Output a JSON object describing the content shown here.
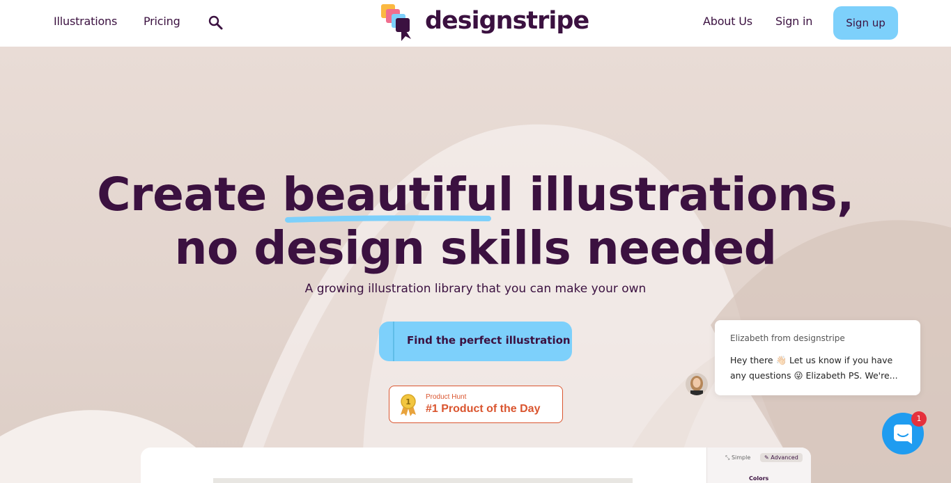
{
  "header": {
    "nav_left": [
      {
        "label": "Illustrations"
      },
      {
        "label": "Pricing"
      }
    ],
    "search_icon": "search-icon",
    "logo_text": "designstripe",
    "nav_right": [
      {
        "label": "About Us"
      },
      {
        "label": "Sign in"
      }
    ],
    "signup_label": "Sign up"
  },
  "hero": {
    "headline_part1": "Create ",
    "headline_highlight": "beautiful",
    "headline_part2": " illustrations,",
    "headline_line2": "no design skills needed",
    "subline": "A growing illustration library that you can make your own",
    "cta_label": "Find the perfect illustration",
    "product_hunt": {
      "small": "Product Hunt",
      "big": "#1 Product of the Day",
      "medal_number": "1"
    }
  },
  "preview": {
    "toggle_simple": "Simple",
    "toggle_advanced": "Advanced",
    "colors_label": "Colors"
  },
  "chat": {
    "from": "Elizabeth from designstripe",
    "message": "Hey there 👋🏻 Let us know if you have any questions 😜 Elizabeth PS. We're...",
    "unread_count": "1"
  },
  "colors": {
    "brand_dark": "#3b1140",
    "accent_blue": "#7dd0fb",
    "product_hunt": "#da552f",
    "chat_blue": "#1f9cf0"
  }
}
